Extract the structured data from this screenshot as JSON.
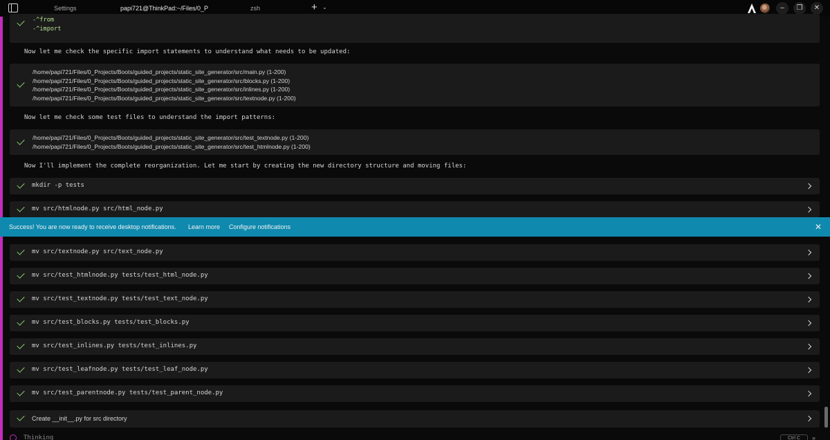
{
  "tabs": {
    "settings": "Settings",
    "active": "papi721@ThinkPad:~/Files/0_P",
    "zsh": "zsh"
  },
  "titlebar": {
    "new_tab": "+",
    "dropdown": "⌄",
    "minimize": "–",
    "restore": "❐",
    "close": "✕"
  },
  "grep_block": {
    "patterns": [
      "-^from",
      "-^import"
    ]
  },
  "messages": {
    "check_imports": "Now let me check the specific import statements to understand what needs to be updated:",
    "check_tests": "Now let me check some test files to understand the import patterns:",
    "implement": "Now I'll implement the complete reorganization. Let me start by creating the new directory structure and moving files:"
  },
  "read_block_1": [
    "/home/papi721/Files/0_Projects/Boots/guided_projects/static_site_generator/src/main.py (1-200)",
    "/home/papi721/Files/0_Projects/Boots/guided_projects/static_site_generator/src/blocks.py (1-200)",
    "/home/papi721/Files/0_Projects/Boots/guided_projects/static_site_generator/src/inlines.py (1-200)",
    "/home/papi721/Files/0_Projects/Boots/guided_projects/static_site_generator/src/textnode.py (1-200)"
  ],
  "read_block_2": [
    "/home/papi721/Files/0_Projects/Boots/guided_projects/static_site_generator/src/test_textnode.py (1-200)",
    "/home/papi721/Files/0_Projects/Boots/guided_projects/static_site_generator/src/test_htmlnode.py (1-200)"
  ],
  "commands": [
    "mkdir -p tests",
    "mv src/htmlnode.py src/html_node.py",
    "mv src/textnode.py src/text_node.py",
    "mv src/test_htmlnode.py tests/test_html_node.py",
    "mv src/test_textnode.py tests/test_text_node.py",
    "mv src/test_blocks.py tests/test_blocks.py",
    "mv src/test_inlines.py tests/test_inlines.py",
    "mv src/test_leafnode.py tests/test_leaf_node.py",
    "mv src/test_parentnode.py tests/test_parent_node.py",
    "Create __init__.py for src directory"
  ],
  "notification": {
    "message": "Success! You are now ready to receive desktop notifications.",
    "learn_more": "Learn more",
    "configure": "Configure notifications",
    "close": "✕"
  },
  "status": {
    "thinking": "Thinking",
    "shortcut": "Ctrl C"
  },
  "colors": {
    "accent": "#c22dbd",
    "check": "#8bcf6f",
    "notification_bg": "#0f89ae",
    "tab_underline": "#1fa3c4"
  }
}
